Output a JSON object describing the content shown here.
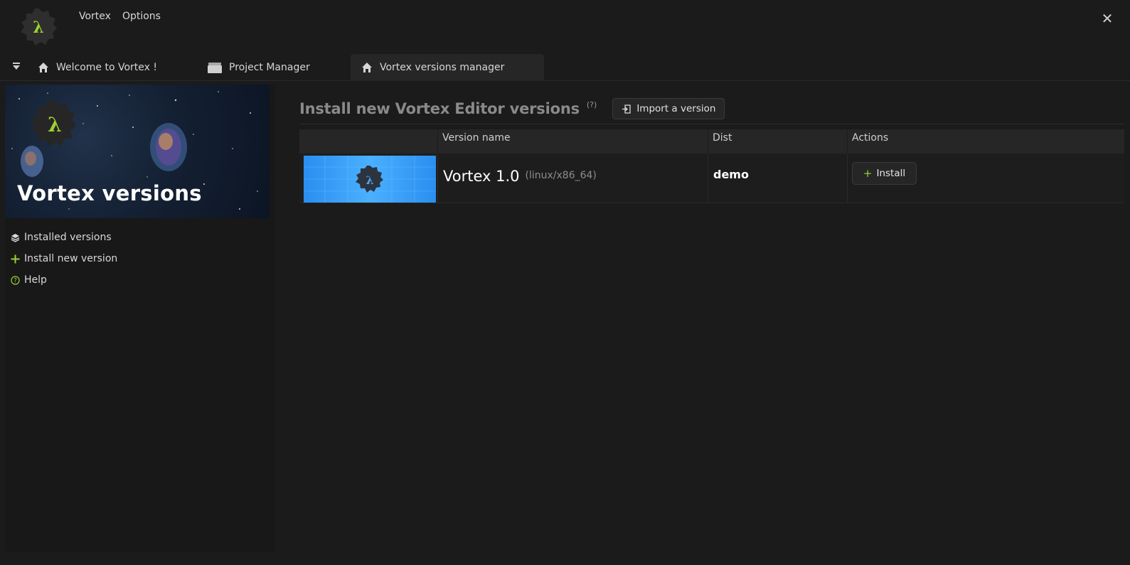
{
  "app": {
    "menu": [
      "Vortex",
      "Options"
    ],
    "close_icon": "close-icon"
  },
  "tabs": [
    {
      "label": "Welcome to Vortex !",
      "icon": "home-icon"
    },
    {
      "label": "Project Manager",
      "icon": "box-icon"
    },
    {
      "label": "Vortex versions manager",
      "icon": "home-icon"
    }
  ],
  "sidebar": {
    "banner_title": "Vortex versions",
    "items": [
      {
        "label": "Installed versions",
        "icon": "layers-icon"
      },
      {
        "label": "Install new version",
        "icon": "plus-icon"
      },
      {
        "label": "Help",
        "icon": "help-circle-icon"
      }
    ]
  },
  "main": {
    "heading": "Install new Vortex Editor versions",
    "help_marker": "(?)",
    "import_button": "Import a version",
    "table": {
      "headers": [
        "",
        "Version name",
        "Dist",
        "Actions"
      ],
      "rows": [
        {
          "name": "Vortex 1.0",
          "platform": "(linux/x86_64)",
          "dist": "demo",
          "action": "Install"
        }
      ]
    }
  },
  "colors": {
    "accent": "#9bd42e",
    "background": "#1b1b1b",
    "panel": "#262626"
  }
}
